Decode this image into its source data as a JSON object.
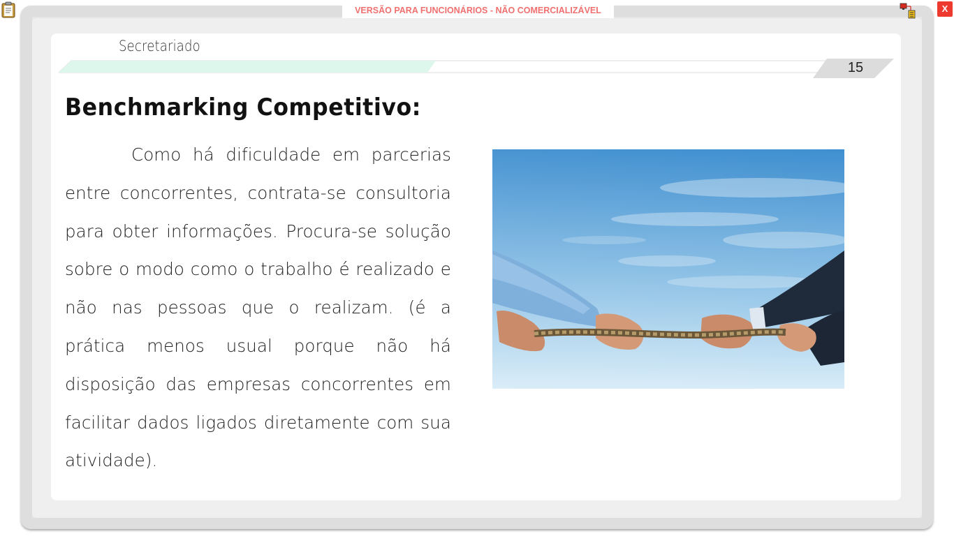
{
  "watermark": "VERSÃO PARA FUNCIONÁRIOS - NÃO COMERCIALIZÁVEL",
  "window": {
    "close_label": "X"
  },
  "slide": {
    "course_title": "Secretariado",
    "page_number": "15",
    "heading": "Benchmarking Competitivo:",
    "body_text": "Como há dificuldade em parcerias entre concorrentes, contrata-se consultoria para obter informações. Procura-se solução sobre o modo como o trabalho é realizado e não nas pessoas que o realizam. (é a prática menos usual porque não há disposição das empresas concorrentes em facilitar dados ligados diretamente com sua atividade).",
    "image_subject": "tug-of-war-rope-hands-photo"
  },
  "colors": {
    "accent_bar": "#ddf7ec",
    "watermark_text": "#f07070",
    "close_button": "#ee3a2e",
    "frame": "#e6e6e6"
  }
}
